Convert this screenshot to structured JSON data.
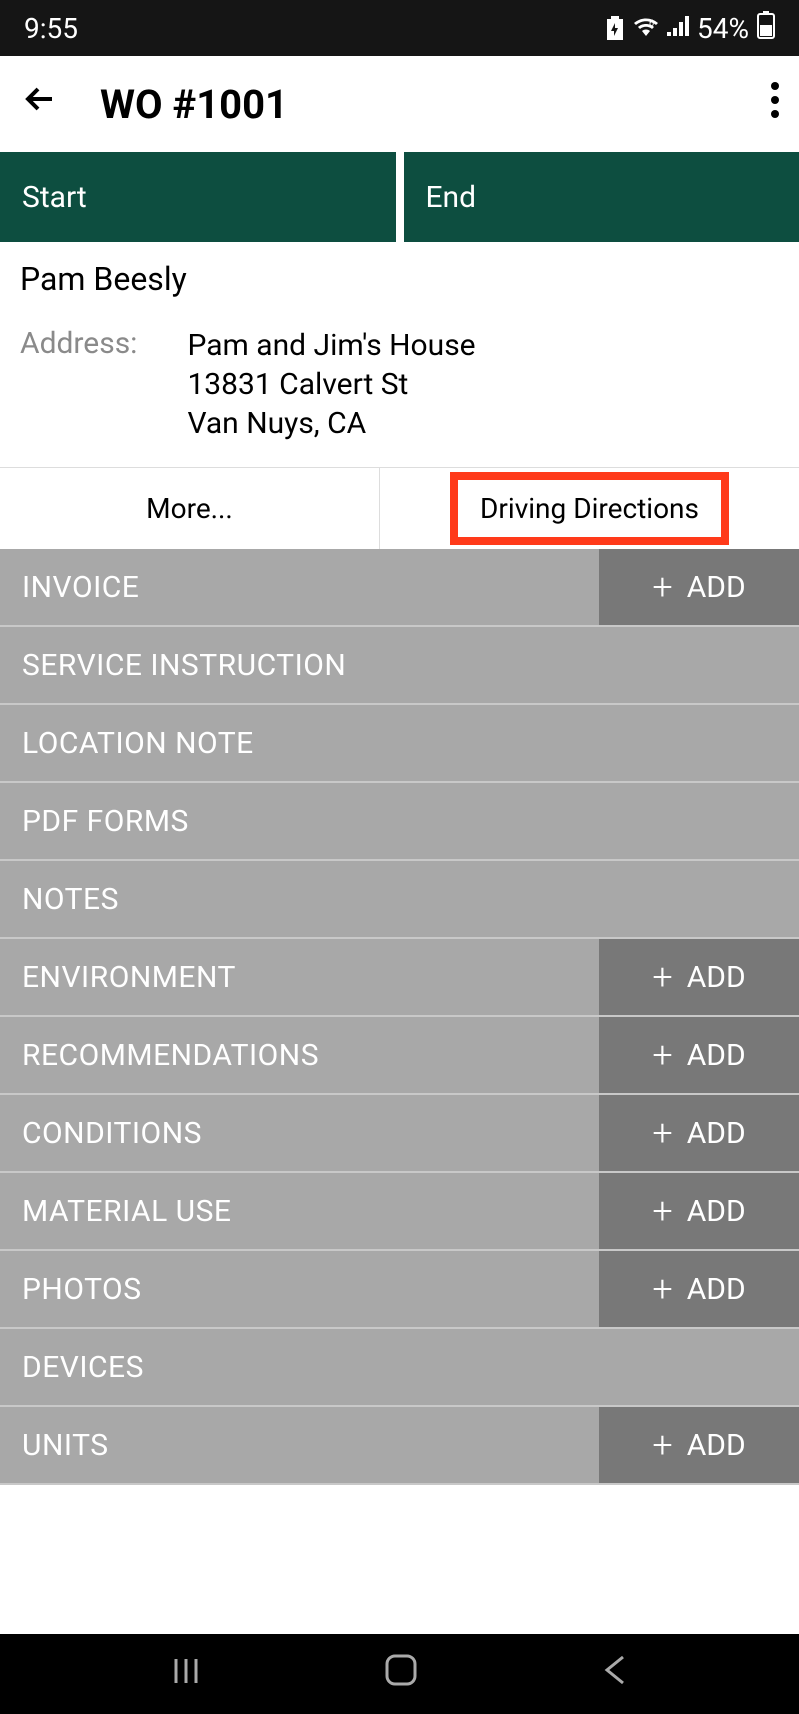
{
  "status_bar": {
    "time": "9:55",
    "battery": "54%"
  },
  "app_bar": {
    "title": "WO #1001"
  },
  "tabs": {
    "start": "Start",
    "end": "End"
  },
  "customer": {
    "name": "Pam Beesly",
    "address_label": "Address:",
    "address_line1": "Pam and Jim's House",
    "address_line2": "13831 Calvert St",
    "address_line3": "Van Nuys, CA"
  },
  "actions": {
    "more": "More...",
    "directions": "Driving Directions"
  },
  "add_label": "ADD",
  "sections": [
    {
      "label": "INVOICE",
      "has_add": true
    },
    {
      "label": "SERVICE INSTRUCTION",
      "has_add": false
    },
    {
      "label": "LOCATION NOTE",
      "has_add": false
    },
    {
      "label": "PDF FORMS",
      "has_add": false
    },
    {
      "label": "NOTES",
      "has_add": false
    },
    {
      "label": "ENVIRONMENT",
      "has_add": true
    },
    {
      "label": "RECOMMENDATIONS",
      "has_add": true
    },
    {
      "label": "CONDITIONS",
      "has_add": true
    },
    {
      "label": "MATERIAL USE",
      "has_add": true
    },
    {
      "label": "PHOTOS",
      "has_add": true
    },
    {
      "label": "DEVICES",
      "has_add": false
    },
    {
      "label": "UNITS",
      "has_add": true
    }
  ]
}
